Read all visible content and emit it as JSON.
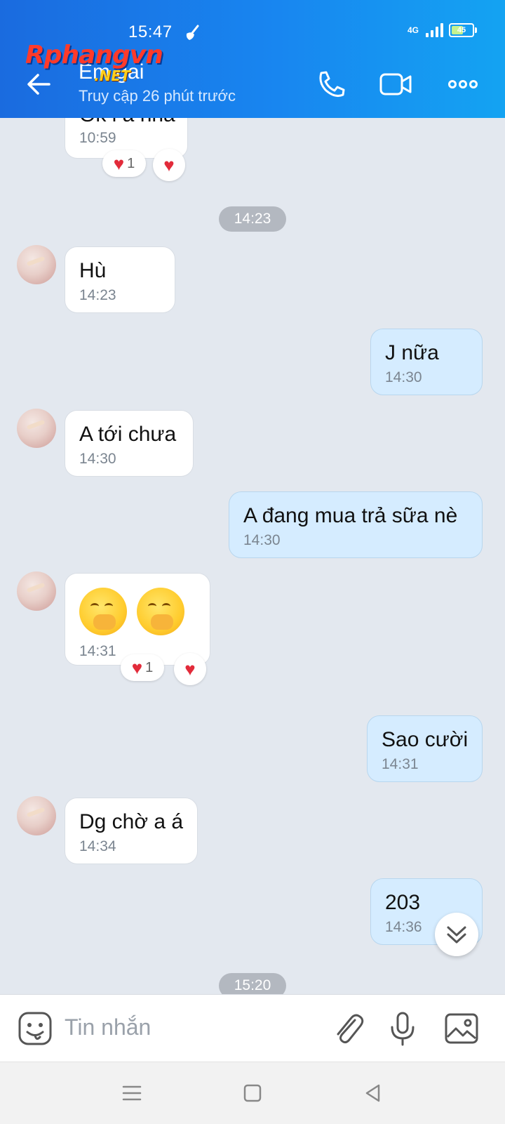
{
  "status_bar": {
    "time": "15:47",
    "network": "4G",
    "battery": "45"
  },
  "watermark": {
    "brand": "Rphangvn",
    "suffix": ".NET"
  },
  "header": {
    "contact_name": "Em gai",
    "last_seen": "Truy cập 26 phút trước"
  },
  "messages": [
    {
      "text": "Ok l a nha",
      "time": "10:59",
      "reaction_count": "1"
    },
    {
      "separator": "14:23"
    },
    {
      "text": "Hù",
      "time": "14:23"
    },
    {
      "text": "J nữa",
      "time": "14:30"
    },
    {
      "text": "A tới chưa",
      "time": "14:30"
    },
    {
      "text": "A đang mua trả sữa nè",
      "time": "14:30"
    },
    {
      "time": "14:31",
      "reaction_count": "1",
      "emojis": [
        "face-with-hand-over-mouth",
        "face-with-hand-over-mouth"
      ]
    },
    {
      "text": "Sao cười",
      "time": "14:31"
    },
    {
      "text": "Dg chờ a á",
      "time": "14:34"
    },
    {
      "text": "203",
      "time": "14:36"
    },
    {
      "separator": "15:20"
    }
  ],
  "input": {
    "placeholder": "Tin nhắn"
  },
  "colors": {
    "header": "#1886f0",
    "incoming": "#ffffff",
    "outgoing": "#d5ecff",
    "chat_bg": "#e3e8ef"
  }
}
